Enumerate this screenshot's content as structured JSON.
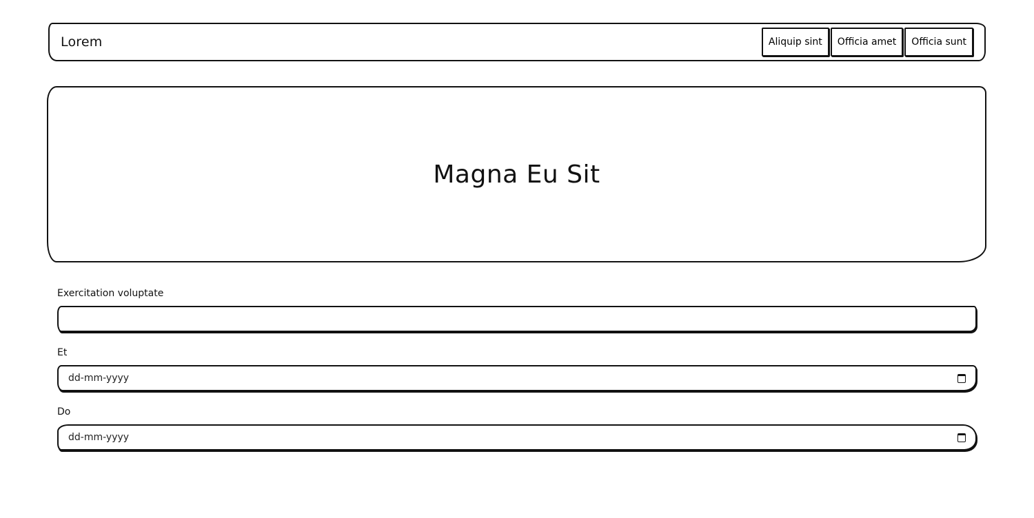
{
  "navbar": {
    "brand": "Lorem",
    "buttons": [
      {
        "label": "Aliquip sint"
      },
      {
        "label": "Officia amet"
      },
      {
        "label": "Officia sunt"
      }
    ]
  },
  "hero": {
    "title": "Magna Eu Sit"
  },
  "form": {
    "fields": [
      {
        "label": "Exercitation voluptate",
        "type": "text",
        "value": ""
      },
      {
        "label": "Et",
        "type": "date",
        "placeholder": "dd-mm-yyyy",
        "icon": "calendar-icon"
      },
      {
        "label": "Do",
        "type": "date",
        "placeholder": "dd-mm-yyyy",
        "icon": "calendar-icon"
      }
    ]
  },
  "colors": {
    "ink": "#111111",
    "background": "#ffffff"
  }
}
